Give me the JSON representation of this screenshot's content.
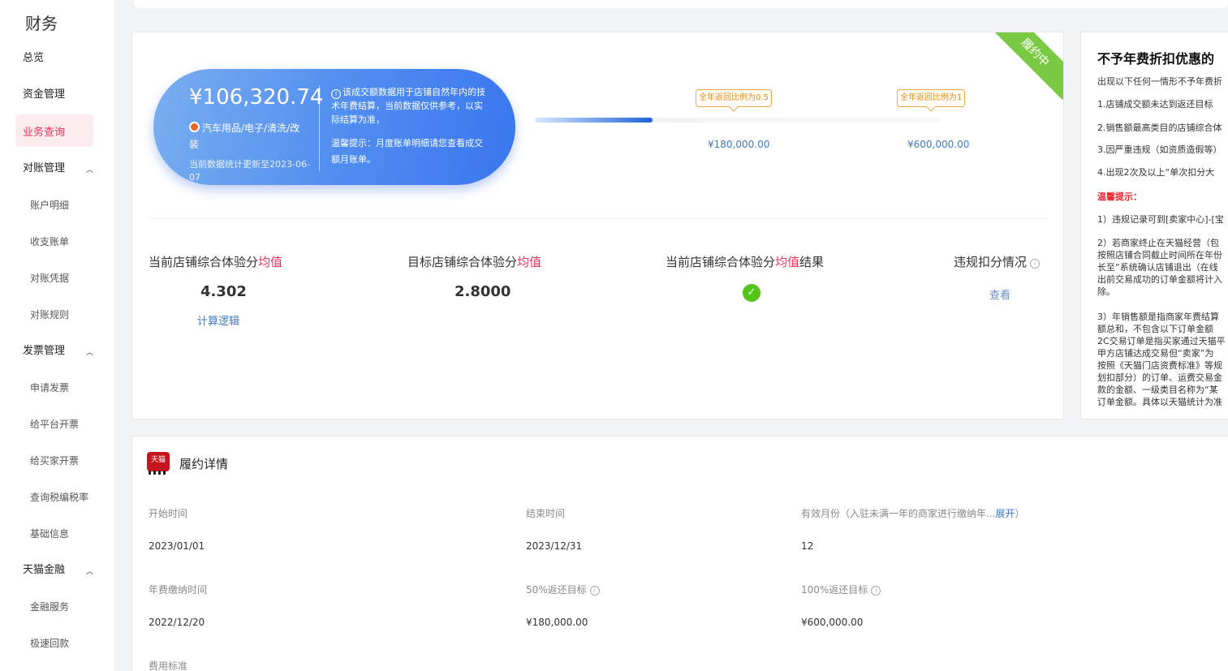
{
  "sidebar": {
    "title": "财务",
    "active": "业务查询",
    "items": [
      {
        "label": "总览"
      },
      {
        "label": "资金管理"
      },
      {
        "label": "业务查询"
      },
      {
        "label": "对账管理",
        "children": [
          "账户明细",
          "收支账单",
          "对账凭据",
          "对账规则"
        ]
      },
      {
        "label": "发票管理",
        "children": [
          "申请发票",
          "给平台开票",
          "给买家开票",
          "查询税编税率",
          "基础信息"
        ]
      },
      {
        "label": "天猫金融",
        "children": [
          "金融服务",
          "极速回款"
        ]
      }
    ]
  },
  "summary": {
    "status_ribbon": "履约中",
    "amount": "¥106,320.74",
    "category": "汽车用品/电子/清洗/改装",
    "update_text": "当前数据统计更新至2023-06-07",
    "note": "该成交额数据用于店铺自然年内的技术年费结算，当前数据仅供参考，以实际结算为准，",
    "tip": "温馨提示：月度账单明细请您查看成交额月账单。",
    "progress_fraction": 0.29,
    "milestones": [
      {
        "tag": "全年返回比例为0.5",
        "amount": "¥180,000.00"
      },
      {
        "tag": "全年返回比例为1",
        "amount": "¥600,000.00"
      }
    ],
    "metrics": [
      {
        "label_prefix": "当前店铺综合体验分",
        "label_highlight": "均值",
        "value": "4.302",
        "link": "计算逻辑"
      },
      {
        "label_prefix": "目标店铺综合体验分",
        "label_highlight": "均值",
        "value": "2.8000"
      },
      {
        "label_prefix": "当前店铺综合体验分",
        "label_highlight": "均值",
        "label_suffix": "结果",
        "status": "pass"
      },
      {
        "label_prefix": "违规扣分情况",
        "link": "查看"
      }
    ],
    "accent_colors": {
      "highlight": "#e8365a",
      "link": "#3f78c0",
      "ribbon": "#7ac943",
      "milestone": "#e58d17"
    }
  },
  "rules": {
    "title": "不予年费折扣优惠的",
    "intro": "出现以下任何一情形不予年费折",
    "items": [
      "1.店铺成交额未达到返还目标",
      "2.销售额最高类目的店铺综合体",
      "3.因严重违规（如资质造假等）",
      "4.出现2次及以上“单次扣分大"
    ],
    "warn_title": "温馨提示：",
    "tips": [
      "1）违规记录可到[卖家中心]-[宝",
      "2）若商家终止在天猫经营（包\n按照店铺合同截止时间所在年份\n长至“系统确认店铺退出（在线\n出前交易成功的订单金额将计入\n除。",
      "3）年销售额是指商家年费结算\n额总和，不包含以下订单金额\n2C交易订单是指买家通过天猫平\n甲方店铺达成交易但“卖家”为\n按照《天猫门店资费标准》等规\n划扣部分）的订单、运费交易金\n款的金额、一级类目名称为“某\n订单金额。具体以天猫统计为准"
    ]
  },
  "details": {
    "title": "履约详情",
    "logo_text": "天猫",
    "fields": [
      {
        "label": "开始时间",
        "value": "2023/01/01"
      },
      {
        "label": "结束时间",
        "value": "2023/12/31"
      },
      {
        "label": "有效月份（入驻未满一年的商家进行缴纳年...",
        "label_link": "展开",
        "label_suffix": "）",
        "value": "12"
      },
      {
        "label": "年费缴纳时间",
        "value": "2022/12/20"
      },
      {
        "label": "50%返还目标",
        "value": "¥180,000.00",
        "info": true
      },
      {
        "label": "100%返还目标",
        "value": "¥600,000.00",
        "info": true
      },
      {
        "label": "费用标准"
      }
    ]
  }
}
